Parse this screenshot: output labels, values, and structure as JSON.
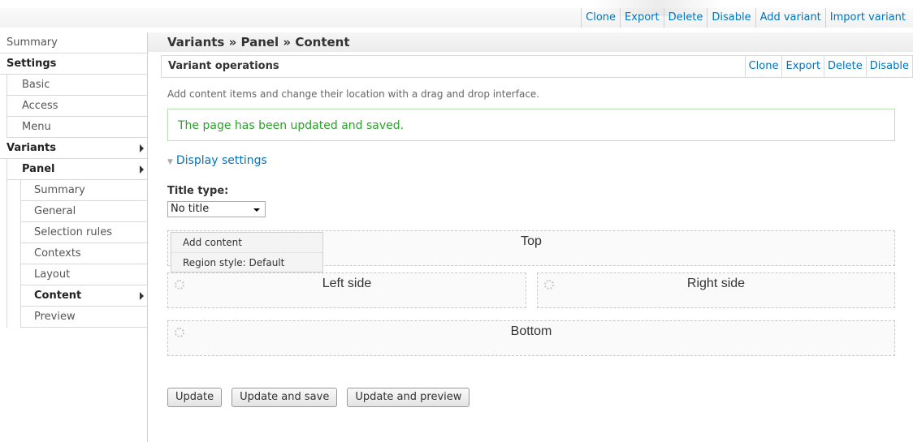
{
  "top_operations": [
    "Clone",
    "Export",
    "Delete",
    "Disable",
    "Add variant",
    "Import variant"
  ],
  "sidebar": {
    "items": [
      {
        "label": "Summary"
      },
      {
        "label": "Settings"
      },
      {
        "label": "Basic"
      },
      {
        "label": "Access"
      },
      {
        "label": "Menu"
      },
      {
        "label": "Variants"
      },
      {
        "label": "Panel"
      },
      {
        "label": "Summary"
      },
      {
        "label": "General"
      },
      {
        "label": "Selection rules"
      },
      {
        "label": "Contexts"
      },
      {
        "label": "Layout"
      },
      {
        "label": "Content"
      },
      {
        "label": "Preview"
      }
    ]
  },
  "main": {
    "breadcrumb": "Variants » Panel » Content",
    "variant_ops_label": "Variant operations",
    "variant_ops": [
      "Clone",
      "Export",
      "Delete",
      "Disable"
    ],
    "description": "Add content items and change their location with a drag and drop interface.",
    "status_message": "The page has been updated and saved.",
    "display_settings": "Display settings",
    "title_type_label": "Title type:",
    "title_type_value": "No title",
    "regions": {
      "top": "Top",
      "left": "Left side",
      "right": "Right side",
      "bottom": "Bottom"
    },
    "region_menu": [
      "Add content",
      "Region style: Default"
    ],
    "buttons": {
      "update": "Update",
      "update_save": "Update and save",
      "update_preview": "Update and preview"
    }
  },
  "colors": {
    "link": "#0074bd",
    "status_text": "#2c9f2c",
    "status_border": "#b8e0b0"
  }
}
